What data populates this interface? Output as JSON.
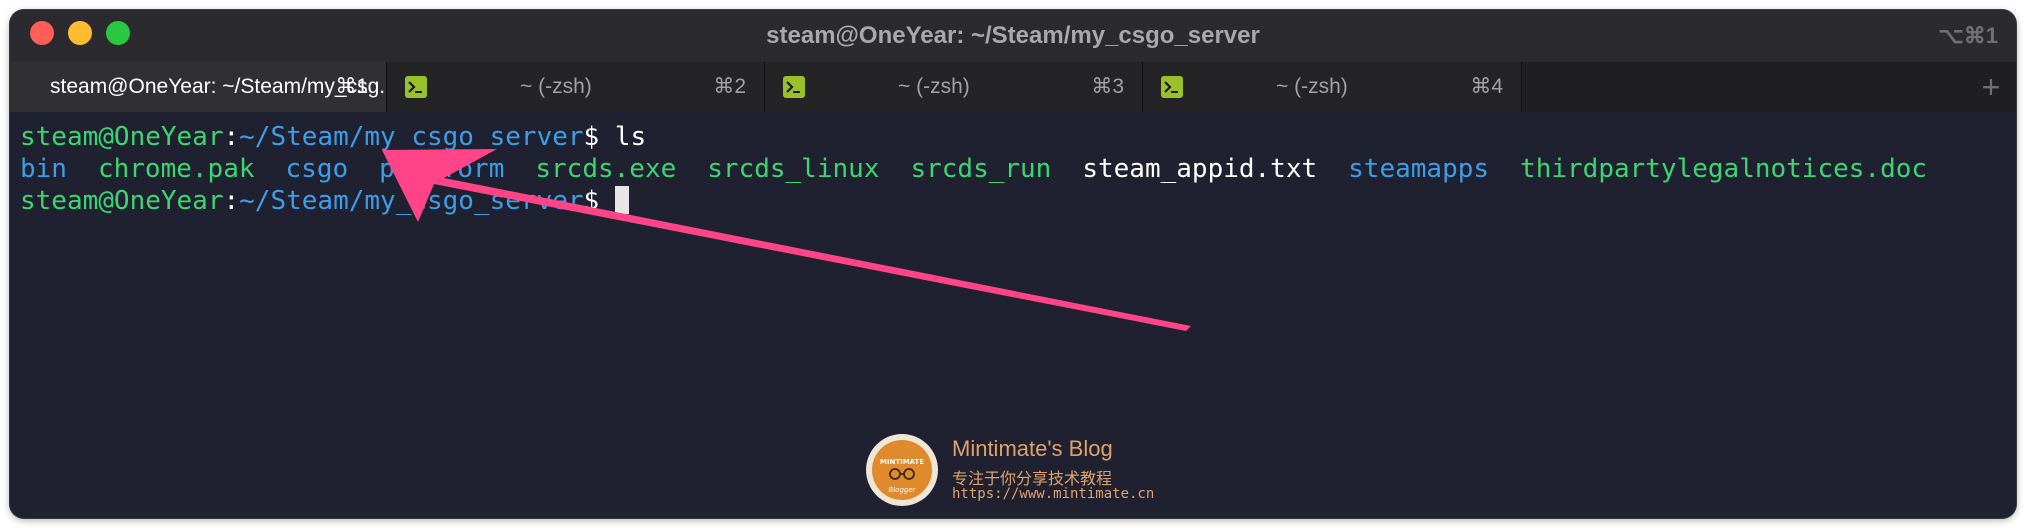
{
  "window": {
    "title": "steam@OneYear: ~/Steam/my_csgo_server",
    "shortcut": "⌥⌘1"
  },
  "tabs": [
    {
      "label": "steam@OneYear: ~/Steam/my_csg...",
      "shortcut": "⌘1",
      "active": true
    },
    {
      "label": "~ (-zsh)",
      "shortcut": "⌘2",
      "active": false
    },
    {
      "label": "~ (-zsh)",
      "shortcut": "⌘3",
      "active": false
    },
    {
      "label": "~ (-zsh)",
      "shortcut": "⌘4",
      "active": false
    }
  ],
  "new_tab_label": "+",
  "terminal": {
    "prompt_user": "steam@OneYear",
    "prompt_sep": ":",
    "prompt_path": "~/Steam/my_csgo_server",
    "prompt_symbol": "$",
    "command": " ls",
    "ls_output": [
      {
        "name": "bin",
        "color": "#3c9ee8"
      },
      {
        "name": "chrome.pak",
        "color": "#3bd671"
      },
      {
        "name": "csgo",
        "color": "#3c9ee8"
      },
      {
        "name": "platform",
        "color": "#3c9ee8"
      },
      {
        "name": "srcds.exe",
        "color": "#3bd671"
      },
      {
        "name": "srcds_linux",
        "color": "#3bd671"
      },
      {
        "name": "srcds_run",
        "color": "#3bd671"
      },
      {
        "name": "steam_appid.txt",
        "color": "#ffffff"
      },
      {
        "name": "steamapps",
        "color": "#3c9ee8"
      },
      {
        "name": "thirdpartylegalnotices.doc",
        "color": "#3bd671"
      }
    ]
  },
  "watermark": {
    "blog_name": "Mintimate's Blog",
    "tagline": "专注于你分享技术教程",
    "url": "https://www.mintimate.cn",
    "logo_text": "MINTIMATE",
    "logo_sub": "Blogger"
  },
  "annotation_arrow_color": "#ff4487"
}
